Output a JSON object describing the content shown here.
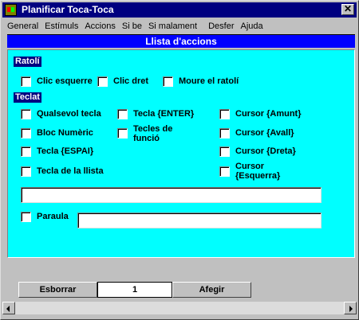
{
  "window": {
    "title": "Planificar Toca-Toca",
    "close_glyph": "✕"
  },
  "menu": [
    "General",
    "Estímuls",
    "Accions",
    "Si be",
    "Si malament",
    "Desfer",
    "Ajuda"
  ],
  "panel": {
    "header": "Llista d'accions"
  },
  "sections": {
    "mouse": {
      "title": "Ratolí",
      "items": [
        "Clic esquerre",
        "Clic dret",
        "Moure el ratolí"
      ]
    },
    "keyboard": {
      "title": "Teclat",
      "items": [
        "Qualsevol tecla",
        "Tecla {ENTER}",
        "Cursor {Amunt}",
        "Bloc Numèric",
        "Tecles de funció",
        "Cursor {Avall}",
        "Tecla {ESPAI}",
        "Cursor {Dreta}",
        "Tecla de la llista",
        "Cursor {Esquerra}"
      ]
    }
  },
  "list_field": {
    "value": ""
  },
  "word": {
    "label": "Paraula",
    "value": ""
  },
  "bottom": {
    "delete_label": "Esborrar",
    "counter": "1",
    "add_label": "Afegir"
  },
  "colors": {
    "panel_bg": "#00ffff",
    "header_bg": "#0000ff",
    "title_bg": "#000080"
  }
}
